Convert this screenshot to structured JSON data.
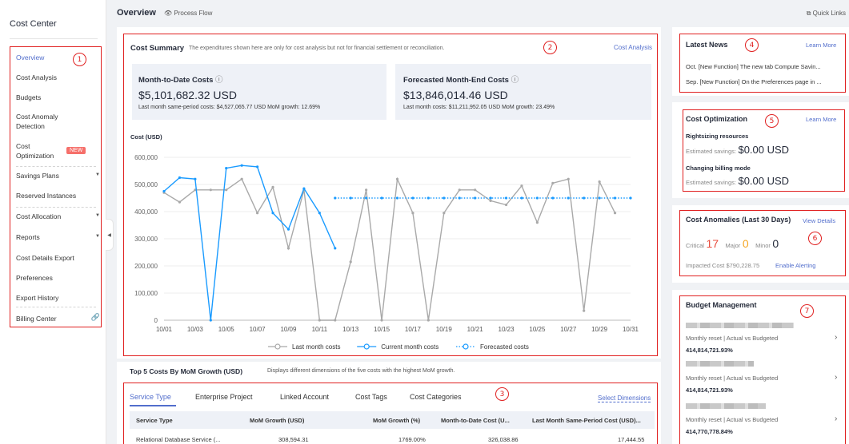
{
  "sidebar": {
    "title": "Cost Center",
    "items": [
      {
        "label": "Overview"
      },
      {
        "label": "Cost Analysis"
      },
      {
        "label": "Budgets"
      },
      {
        "label": "Cost Anomaly"
      },
      {
        "label": "Detection"
      },
      {
        "label": "Cost"
      },
      {
        "label": "Optimization"
      },
      {
        "label": "Savings Plans"
      },
      {
        "label": "Reserved Instances"
      },
      {
        "label": "Cost Allocation"
      },
      {
        "label": "Reports"
      },
      {
        "label": "Cost Details Export"
      },
      {
        "label": "Preferences"
      },
      {
        "label": "Export History"
      },
      {
        "label": "Billing Center"
      }
    ],
    "new_badge": "NEW",
    "marker": "1"
  },
  "header": {
    "title": "Overview",
    "process_flow": "Process Flow",
    "quick_links": "Quick Links"
  },
  "summary": {
    "title": "Cost Summary",
    "desc": "The expenditures shown here are only for cost analysis but not for financial settlement or reconciliation.",
    "link": "Cost Analysis",
    "marker": "2",
    "mtd": {
      "label": "Month-to-Date Costs",
      "value": "$5,101,682.32 USD",
      "sub": "Last month same-period costs: $4,527,065.77 USD   MoM growth: 12.69%"
    },
    "forecast": {
      "label": "Forecasted Month-End Costs",
      "value": "$13,846,014.46 USD",
      "sub": "Last month costs: $11,211,952.05 USD   MoM growth: 23.49%"
    }
  },
  "chart_data": {
    "type": "line",
    "ylabel": "Cost (USD)",
    "ylim": [
      0,
      600000
    ],
    "yticks": [
      "600,000",
      "500,000",
      "400,000",
      "300,000",
      "200,000",
      "100,000",
      "0"
    ],
    "x_ticks": [
      "10/01",
      "10/03",
      "10/05",
      "10/07",
      "10/09",
      "10/11",
      "10/13",
      "10/15",
      "10/17",
      "10/19",
      "10/21",
      "10/23",
      "10/25",
      "10/27",
      "10/29",
      "10/31"
    ],
    "series": [
      {
        "name": "Last month costs",
        "color": "#a9a9a9",
        "values": [
          470000,
          435000,
          480000,
          480000,
          480000,
          520000,
          395000,
          490000,
          265000,
          480000,
          0,
          0,
          215000,
          480000,
          0,
          520000,
          395000,
          0,
          395000,
          480000,
          480000,
          440000,
          425000,
          495000,
          360000,
          505000,
          520000,
          35000,
          510000,
          395000
        ]
      },
      {
        "name": "Current month costs",
        "color": "#1a9bff",
        "values": [
          475000,
          525000,
          520000,
          0,
          560000,
          570000,
          565000,
          395000,
          335000,
          485000,
          395000,
          265000
        ]
      },
      {
        "name": "Forecasted costs",
        "color": "#1a9bff",
        "start_day": 12,
        "value": 450000,
        "end_day": 31
      }
    ]
  },
  "top5": {
    "title": "Top 5 Costs By MoM Growth (USD)",
    "desc": "Displays different dimensions of the five costs with the highest MoM growth.",
    "marker": "3",
    "tabs": [
      "Service Type",
      "Enterprise Project",
      "Linked Account",
      "Cost Tags",
      "Cost Categories"
    ],
    "select_dimensions": "Select Dimensions",
    "columns": [
      "Service Type",
      "MoM Growth (USD)",
      "MoM Growth (%)",
      "Month-to-Date Cost (U...",
      "Last Month Same-Period Cost (USD)..."
    ],
    "rows": [
      [
        "Relational Database Service (...",
        "308,594.31",
        "1769.00%",
        "326,038.86",
        "17,444.55"
      ]
    ]
  },
  "news": {
    "title": "Latest News",
    "link": "Learn More",
    "marker": "4",
    "items": [
      "Oct. [New Function] The new tab Compute Savin...",
      "Sep. [New Function] On the Preferences page in ..."
    ]
  },
  "optimization": {
    "title": "Cost Optimization",
    "link": "Learn More",
    "marker": "5",
    "rightsizing": "Rightsizing resources",
    "billing": "Changing billing mode",
    "savings_label": "Estimated savings:",
    "savings_value_1": "$0.00 USD",
    "savings_value_2": "$0.00 USD"
  },
  "anomalies": {
    "title": "Cost Anomalies (Last 30 Days)",
    "link": "View Details",
    "marker": "6",
    "critical_label": "Critical",
    "critical": "17",
    "major_label": "Major",
    "major": "0",
    "minor_label": "Minor",
    "minor": "0",
    "impacted": "Impacted Cost $790,228.75",
    "alerting": "Enable Alerting"
  },
  "budget": {
    "title": "Budget Management",
    "marker": "7",
    "items": [
      {
        "meta": "Monthly reset  |  Actual vs Budgeted",
        "value": "414,814,721.93%"
      },
      {
        "meta": "Monthly reset  |  Actual vs Budgeted",
        "value": "414,814,721.93%"
      },
      {
        "meta": "Monthly reset  |  Actual vs Budgeted",
        "value": "414,770,778.84%"
      }
    ]
  },
  "colors": {
    "accent": "#526ecc",
    "marker_red": "#e02020",
    "current": "#1a9bff",
    "last": "#a9a9a9",
    "warning": "#f5a623"
  }
}
